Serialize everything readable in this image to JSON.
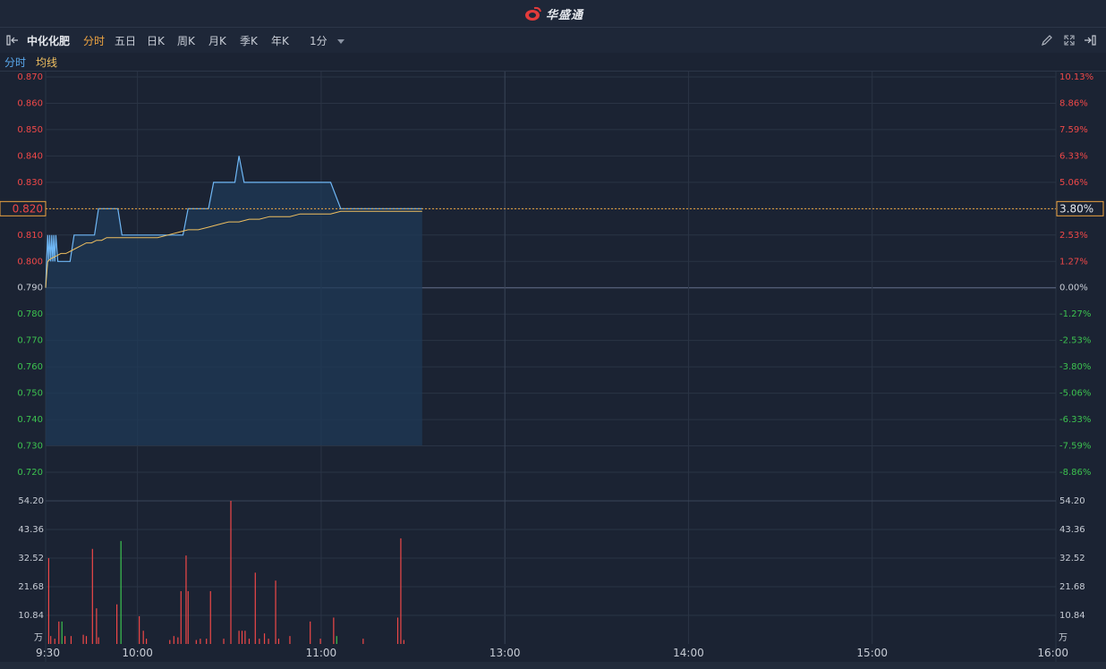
{
  "brand": {
    "name": "华盛通"
  },
  "toolbar": {
    "stock_name": "中化化肥",
    "tabs": [
      "分时",
      "五日",
      "日K",
      "周K",
      "月K",
      "季K",
      "年K"
    ],
    "active_tab": "分时",
    "interval": "1分",
    "icons": [
      "pen-icon",
      "expand-icon",
      "collapse-right-icon"
    ]
  },
  "legend": {
    "price": "分时",
    "avg": "均线"
  },
  "colors": {
    "up": "#f04848",
    "down": "#3cc24f",
    "price_line": "#6fb7f5",
    "avg_line": "#f0c060",
    "bg": "#1b2333",
    "grid": "#2a3445"
  },
  "price_axis": {
    "left_ticks": [
      "0.870",
      "0.860",
      "0.850",
      "0.840",
      "0.830",
      "0.820",
      "0.810",
      "0.800",
      "0.790",
      "0.780",
      "0.770",
      "0.760",
      "0.750",
      "0.740",
      "0.730",
      "0.720"
    ],
    "right_ticks": [
      "10.13%",
      "8.86%",
      "7.59%",
      "6.33%",
      "5.06%",
      "3.80%",
      "2.53%",
      "1.27%",
      "0.00%",
      "-1.27%",
      "-2.53%",
      "-3.80%",
      "-5.06%",
      "-6.33%",
      "-7.59%",
      "-8.86%"
    ],
    "prev_close": 0.79,
    "current_price_label": "0.820",
    "current_pct_label": "3.80%"
  },
  "volume_axis": {
    "ticks": [
      "54.20",
      "43.36",
      "32.52",
      "21.68",
      "10.84"
    ],
    "unit": "万",
    "max": 54.2
  },
  "time_axis": [
    "9:30",
    "10:00",
    "11:00",
    "13:00",
    "14:00",
    "15:00",
    "16:00"
  ],
  "chart_data": {
    "type": "line",
    "xlabel": "",
    "ylabel": "",
    "ylim": [
      0.715,
      0.875
    ],
    "series": [
      {
        "name": "分时",
        "x": [
          0,
          1,
          2,
          3,
          4,
          5,
          6,
          7,
          8,
          9,
          10,
          12,
          15,
          18,
          20,
          24,
          28,
          32,
          34,
          40,
          45,
          48,
          52,
          57,
          60,
          62,
          64,
          68,
          71,
          75,
          80,
          88,
          95,
          98,
          100,
          102,
          104,
          108,
          112,
          118,
          120,
          125,
          130,
          135,
          140,
          145,
          148,
          150,
          152,
          155,
          160,
          165,
          170,
          175,
          180,
          186,
          190,
          195,
          200,
          210,
          220,
          230,
          240,
          250,
          260,
          270,
          280,
          290,
          295,
          300,
          305,
          310,
          315,
          320,
          325,
          330,
          340,
          350,
          360,
          365,
          370
        ],
        "values": [
          0.79,
          0.8,
          0.81,
          0.8,
          0.81,
          0.8,
          0.81,
          0.8,
          0.81,
          0.8,
          0.81,
          0.8,
          0.8,
          0.8,
          0.8,
          0.8,
          0.81,
          0.81,
          0.81,
          0.81,
          0.81,
          0.81,
          0.82,
          0.82,
          0.82,
          0.82,
          0.82,
          0.82,
          0.82,
          0.81,
          0.81,
          0.81,
          0.81,
          0.81,
          0.81,
          0.81,
          0.81,
          0.81,
          0.81,
          0.81,
          0.81,
          0.81,
          0.81,
          0.81,
          0.82,
          0.82,
          0.82,
          0.82,
          0.82,
          0.82,
          0.82,
          0.83,
          0.83,
          0.83,
          0.83,
          0.83,
          0.84,
          0.83,
          0.83,
          0.83,
          0.83,
          0.83,
          0.83,
          0.83,
          0.83,
          0.83,
          0.83,
          0.82,
          0.82,
          0.82,
          0.82,
          0.82,
          0.82,
          0.82,
          0.82,
          0.82,
          0.82,
          0.82,
          0.82,
          0.82,
          0.82
        ]
      },
      {
        "name": "均线",
        "x": [
          0,
          2,
          5,
          10,
          15,
          20,
          25,
          30,
          35,
          40,
          45,
          50,
          55,
          60,
          70,
          80,
          90,
          100,
          110,
          120,
          130,
          140,
          150,
          160,
          170,
          180,
          190,
          200,
          210,
          220,
          230,
          240,
          250,
          260,
          270,
          280,
          290,
          300,
          310,
          320,
          330,
          340,
          350,
          360,
          370
        ],
        "values": [
          0.79,
          0.8,
          0.801,
          0.802,
          0.803,
          0.803,
          0.804,
          0.805,
          0.806,
          0.807,
          0.807,
          0.808,
          0.808,
          0.809,
          0.809,
          0.809,
          0.809,
          0.809,
          0.809,
          0.81,
          0.811,
          0.812,
          0.812,
          0.813,
          0.814,
          0.815,
          0.815,
          0.816,
          0.816,
          0.817,
          0.817,
          0.817,
          0.818,
          0.818,
          0.818,
          0.818,
          0.819,
          0.819,
          0.819,
          0.819,
          0.819,
          0.819,
          0.819,
          0.819,
          0.819
        ]
      }
    ],
    "volume": {
      "unit": "万",
      "ylim": [
        0,
        54.2
      ],
      "bars": [
        {
          "x": 3,
          "v": 32.5,
          "d": "up"
        },
        {
          "x": 5,
          "v": 3,
          "d": "up"
        },
        {
          "x": 9,
          "v": 2,
          "d": "up"
        },
        {
          "x": 13,
          "v": 8.5,
          "d": "up"
        },
        {
          "x": 16,
          "v": 8.5,
          "d": "down"
        },
        {
          "x": 19,
          "v": 3,
          "d": "up"
        },
        {
          "x": 25,
          "v": 3,
          "d": "up"
        },
        {
          "x": 37,
          "v": 3.5,
          "d": "up"
        },
        {
          "x": 40,
          "v": 3,
          "d": "up"
        },
        {
          "x": 46,
          "v": 36,
          "d": "up"
        },
        {
          "x": 50,
          "v": 13.5,
          "d": "up"
        },
        {
          "x": 52,
          "v": 2.5,
          "d": "up"
        },
        {
          "x": 70,
          "v": 15,
          "d": "up"
        },
        {
          "x": 74,
          "v": 39,
          "d": "down"
        },
        {
          "x": 92,
          "v": 10.5,
          "d": "up"
        },
        {
          "x": 96,
          "v": 5,
          "d": "up"
        },
        {
          "x": 99,
          "v": 2,
          "d": "up"
        },
        {
          "x": 122,
          "v": 1.5,
          "d": "up"
        },
        {
          "x": 126,
          "v": 3,
          "d": "up"
        },
        {
          "x": 130,
          "v": 2.5,
          "d": "up"
        },
        {
          "x": 133,
          "v": 20,
          "d": "up"
        },
        {
          "x": 138,
          "v": 33.5,
          "d": "up"
        },
        {
          "x": 140,
          "v": 20,
          "d": "up"
        },
        {
          "x": 148,
          "v": 1.5,
          "d": "up"
        },
        {
          "x": 152,
          "v": 2,
          "d": "up"
        },
        {
          "x": 158,
          "v": 2,
          "d": "up"
        },
        {
          "x": 162,
          "v": 20,
          "d": "up"
        },
        {
          "x": 175,
          "v": 2,
          "d": "up"
        },
        {
          "x": 182,
          "v": 54.2,
          "d": "up"
        },
        {
          "x": 190,
          "v": 5,
          "d": "up"
        },
        {
          "x": 193,
          "v": 5,
          "d": "up"
        },
        {
          "x": 196,
          "v": 5,
          "d": "up"
        },
        {
          "x": 200,
          "v": 2,
          "d": "up"
        },
        {
          "x": 206,
          "v": 27,
          "d": "up"
        },
        {
          "x": 210,
          "v": 2,
          "d": "up"
        },
        {
          "x": 215,
          "v": 4,
          "d": "up"
        },
        {
          "x": 219,
          "v": 2,
          "d": "up"
        },
        {
          "x": 226,
          "v": 24,
          "d": "up"
        },
        {
          "x": 229,
          "v": 2,
          "d": "up"
        },
        {
          "x": 240,
          "v": 3,
          "d": "up"
        },
        {
          "x": 260,
          "v": 8.5,
          "d": "up"
        },
        {
          "x": 270,
          "v": 2,
          "d": "up"
        },
        {
          "x": 283,
          "v": 10,
          "d": "up"
        },
        {
          "x": 286,
          "v": 3,
          "d": "down"
        },
        {
          "x": 312,
          "v": 2,
          "d": "up"
        },
        {
          "x": 346,
          "v": 10,
          "d": "up"
        },
        {
          "x": 349,
          "v": 40,
          "d": "up"
        },
        {
          "x": 352,
          "v": 1.5,
          "d": "up"
        }
      ]
    }
  }
}
